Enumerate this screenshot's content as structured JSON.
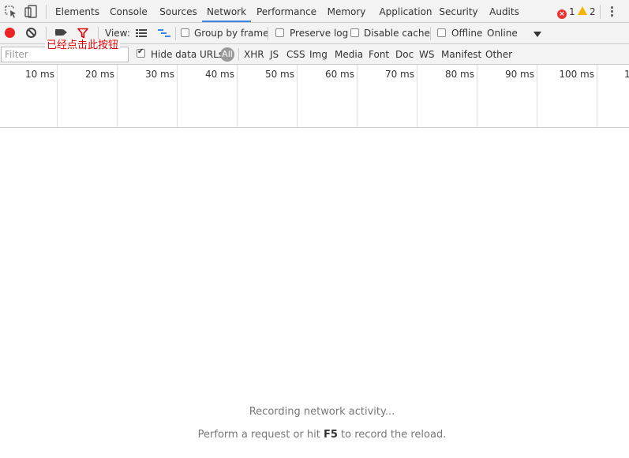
{
  "tabs": [
    "Elements",
    "Console",
    "Sources",
    "Network",
    "Performance",
    "Memory",
    "Application",
    "Security",
    "Audits"
  ],
  "active_tab": "Network",
  "status": {
    "errors": "1",
    "warnings": "2"
  },
  "toolbar": {
    "view_label": "View:",
    "group_by_frame": "Group by frame",
    "preserve_log": "Preserve log",
    "disable_cache": "Disable cache",
    "offline": "Offline",
    "throttle": "Online"
  },
  "annotation": "已经点击此按钮",
  "filter": {
    "placeholder": "Filter",
    "hide_data_urls": "Hide data URLs",
    "all": "All",
    "types": [
      "XHR",
      "JS",
      "CSS",
      "Img",
      "Media",
      "Font",
      "Doc",
      "WS",
      "Manifest",
      "Other"
    ]
  },
  "timeline": {
    "ticks": [
      "10 ms",
      "20 ms",
      "30 ms",
      "40 ms",
      "50 ms",
      "60 ms",
      "70 ms",
      "80 ms",
      "90 ms",
      "100 ms",
      "1"
    ]
  },
  "empty": {
    "line1": "Recording network activity...",
    "line2_before": "Perform a request or hit ",
    "line2_key": "F5",
    "line2_after": " to record the reload."
  },
  "colors": {
    "record": "#e22222",
    "filter_active": "#e00000",
    "annotation": "#e00000",
    "active_tab_underline": "#3a84e5"
  }
}
